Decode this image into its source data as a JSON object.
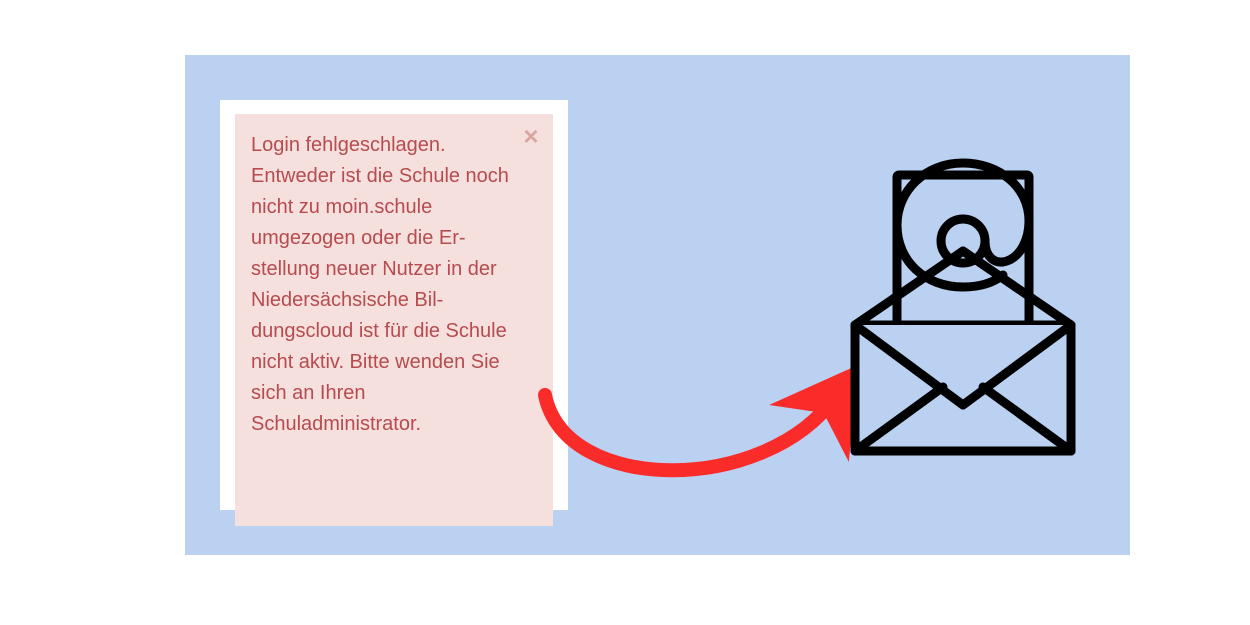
{
  "alert": {
    "message": "Login fehlgeschlagen. Entweder ist die Schule noch nicht zu moin.schule umgezogen oder die Er­stellung neuer Nutzer in der Niedersächsische Bil­dungscloud ist für die Schule nicht aktiv. Bitte wenden Sie sich an Ihren Schuladministrator.",
    "close_glyph": "×"
  },
  "colors": {
    "stage_bg": "#bbd1f2",
    "alert_bg": "#f5e0dd",
    "alert_text": "#b74b4f",
    "arrow": "#fa2c2a",
    "icon_stroke": "#000000"
  },
  "icons": {
    "envelope_symbol": "@"
  }
}
